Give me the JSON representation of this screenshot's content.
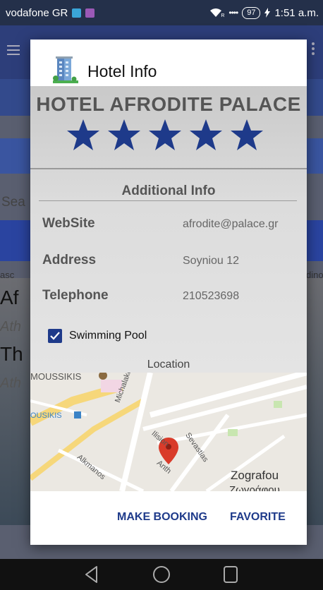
{
  "status_bar": {
    "carrier": "vodafone GR",
    "battery": "97",
    "signal_mark": "R",
    "time": "1:51 a.m."
  },
  "background": {
    "fragments": [
      "Sea",
      "asc",
      "dino",
      "Af",
      "Ath",
      "Th",
      "Ath"
    ]
  },
  "dialog": {
    "title": "Hotel Info",
    "hotel_name": "HOTEL AFRODITE PALACE",
    "rating": 5,
    "rating_max": 5,
    "additional_info_title": "Additional Info",
    "info": {
      "website_label": "WebSite",
      "website_value": "afrodite@palace.gr",
      "address_label": "Address",
      "address_value": "Soyniou 12",
      "telephone_label": "Telephone",
      "telephone_value": "210523698"
    },
    "amenity": {
      "label": "Swimming Pool",
      "checked": true
    },
    "location_label": "Location",
    "map": {
      "labels": [
        "MOUSSIKIS",
        "OUSIKIS",
        "Michalakopoulou",
        "Ilision",
        "Sevastias",
        "Alkmanos",
        "Anth",
        "Zografou",
        "Ζωγράφου"
      ]
    },
    "actions": {
      "make_booking": "MAKE BOOKING",
      "favorite": "FAVORITE"
    }
  },
  "colors": {
    "accent": "#1e3a8a",
    "star": "#1e3a8a",
    "pin": "#d93b2a"
  }
}
